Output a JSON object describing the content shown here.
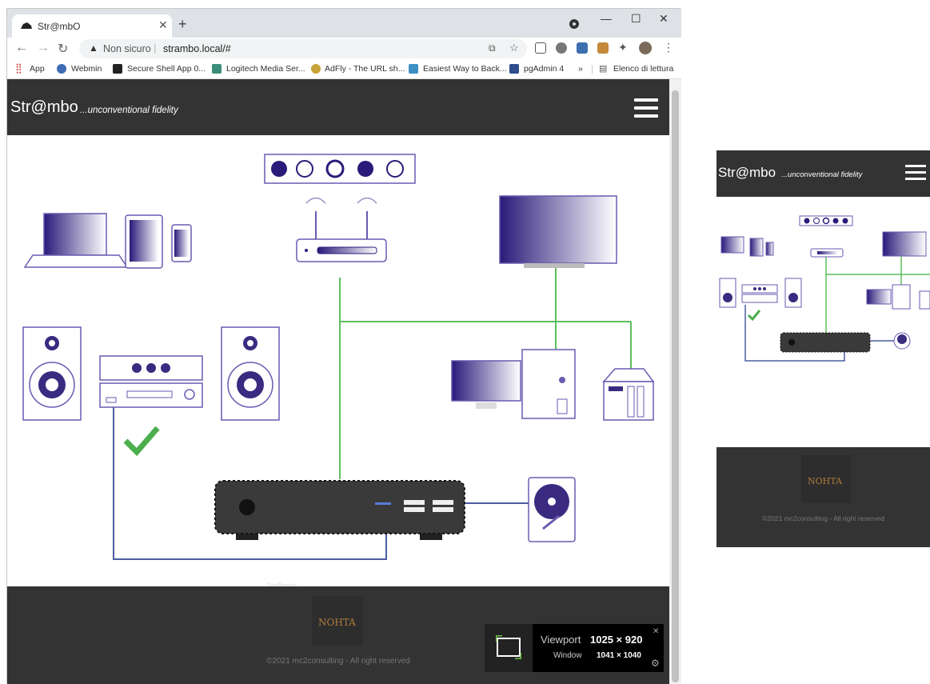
{
  "browser": {
    "tab_title": "Str@mbO",
    "omnibox": {
      "security_label": "Non sicuro",
      "url": "strambo.local/#"
    },
    "bookmarks": [
      "App",
      "Webmin",
      "Secure Shell App 0...",
      "Logitech Media Ser...",
      "AdFly - The URL sh...",
      "Easiest Way to Back...",
      "pgAdmin 4",
      "»",
      "Elenco di lettura"
    ]
  },
  "site": {
    "brand": "Str@mbo",
    "tagline": "...unconventional fidelity",
    "device_label": "Str@mbo",
    "footer_logo": "NOHTA",
    "copyright": "©2021 mc2consulting - All right reserved"
  },
  "overlay": {
    "viewport_label": "Viewport",
    "viewport_value": "1025 × 920",
    "window_label": "Window",
    "window_value": "1041 × 1040"
  },
  "colors": {
    "header_bg": "#333333",
    "accent_purple": "#3a2a80",
    "line_green": "#5cbf5c",
    "line_blue": "#4a5ea0",
    "check_green": "#4cae4c"
  }
}
